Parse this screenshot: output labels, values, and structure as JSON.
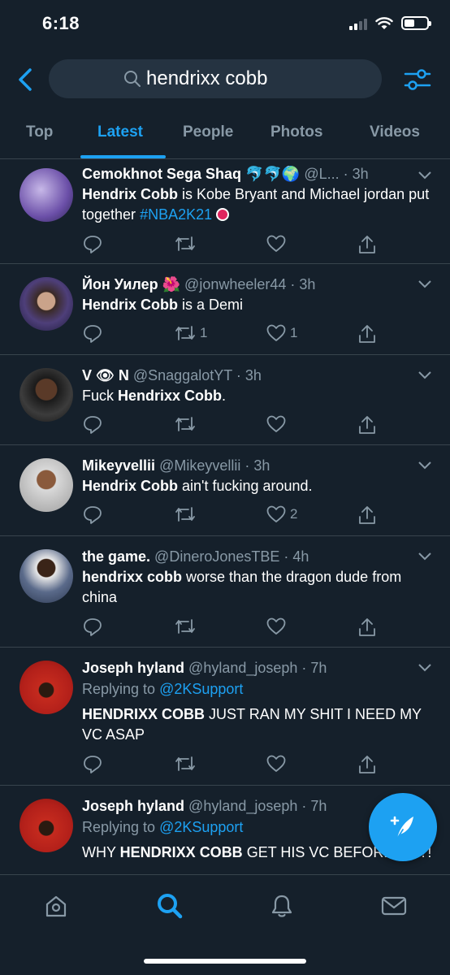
{
  "status": {
    "time": "6:18"
  },
  "search": {
    "query": "hendrixx cobb"
  },
  "tabs": [
    {
      "label": "Top"
    },
    {
      "label": "Latest"
    },
    {
      "label": "People"
    },
    {
      "label": "Photos"
    },
    {
      "label": "Videos"
    }
  ],
  "tweets": [
    {
      "name": "Cemokhnot Sega Shaq",
      "name_emoji": "🐬🐬🌍",
      "handle_time": "@L... · 3h",
      "text_bold": "Hendrix Cobb",
      "text_rest": " is Kobe Bryant and Michael jordan put together ",
      "hashtag": "#NBA2K21",
      "reply_count": "",
      "retweet_count": "",
      "like_count": ""
    },
    {
      "name": "Йон Уилер",
      "name_emoji": "🌺",
      "handle_time": "@jonwheeler44 · 3h",
      "text_bold": "Hendrix Cobb",
      "text_rest": " is a Demi",
      "retweet_count": "1",
      "like_count": "1"
    },
    {
      "name": "V 👁 N",
      "handle_time": "@SnaggalotYT · 3h",
      "text_pre": "Fuck ",
      "text_bold": "Hendrixx Cobb",
      "text_rest": ".",
      "retweet_count": "",
      "like_count": ""
    },
    {
      "name": "Mikeyvellii",
      "handle_time": "@Mikeyvellii · 3h",
      "text_bold": "Hendrix Cobb",
      "text_rest": " ain't fucking around.",
      "like_count": "2"
    },
    {
      "name": "the game.",
      "handle_time": "@DineroJonesTBE · 4h",
      "text_bold": "hendrixx cobb",
      "text_rest": " worse than the dragon dude from china"
    },
    {
      "name": "Joseph hyland",
      "handle_time": "@hyland_joseph · 7h",
      "reply_label": "Replying to ",
      "reply_handle": "@2KSupport",
      "text_bold": "HENDRIXX COBB",
      "text_rest": " JUST RAN MY SHIT I NEED MY VC ASAP"
    },
    {
      "name": "Joseph hyland",
      "handle_time": "@hyland_joseph · 7h",
      "reply_label": "Replying to ",
      "reply_handle": "@2KSupport",
      "text_pre": "WHY ",
      "text_bold": "HENDRIXX COBB",
      "text_rest": " GET HIS VC BEFORE ME?!"
    }
  ],
  "colors": {
    "accent": "#1da1f2",
    "background": "#15202b",
    "muted": "#8899a6",
    "divider": "#38444d"
  },
  "icons": [
    "back-icon",
    "search-icon",
    "filter-icon",
    "chevron-down-icon",
    "reply-icon",
    "retweet-icon",
    "like-icon",
    "share-icon",
    "compose-icon",
    "home-icon",
    "explore-icon",
    "notifications-icon",
    "messages-icon"
  ]
}
